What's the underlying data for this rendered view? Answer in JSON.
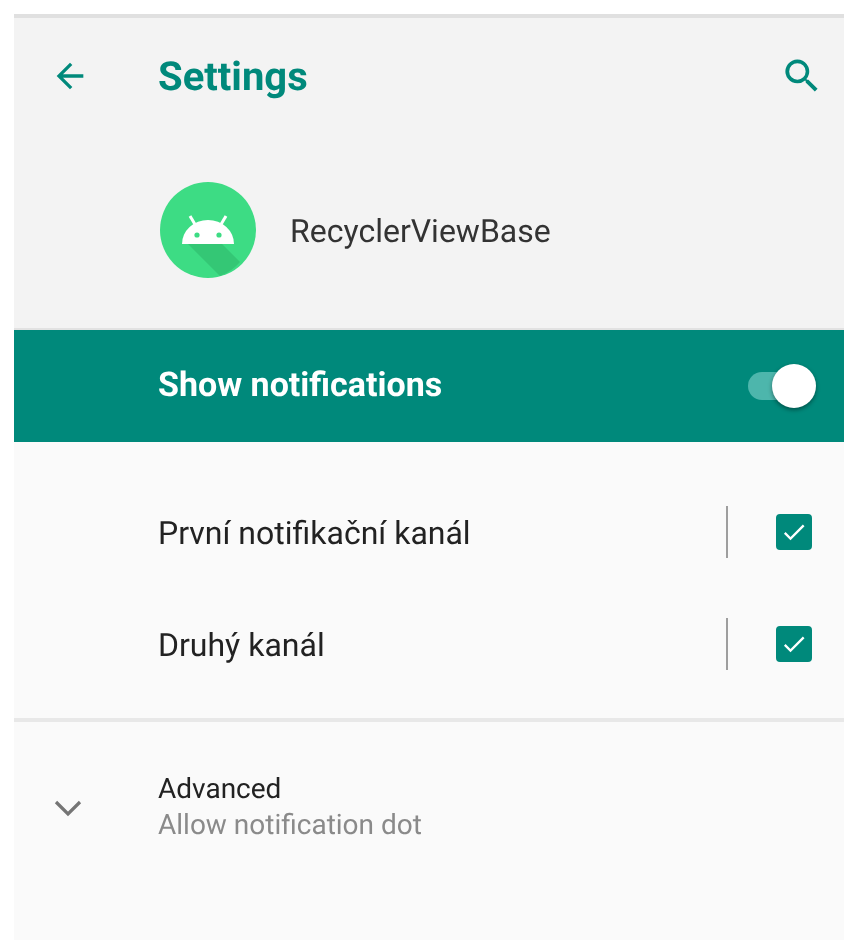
{
  "toolbar": {
    "title": "Settings"
  },
  "app": {
    "name": "RecyclerViewBase"
  },
  "master_switch": {
    "label": "Show notifications",
    "on": true
  },
  "channels": [
    {
      "name": "První notifikační kanál",
      "checked": true
    },
    {
      "name": "Druhý kanál",
      "checked": true
    }
  ],
  "advanced": {
    "title": "Advanced",
    "summary": "Allow notification dot",
    "expanded": false
  }
}
